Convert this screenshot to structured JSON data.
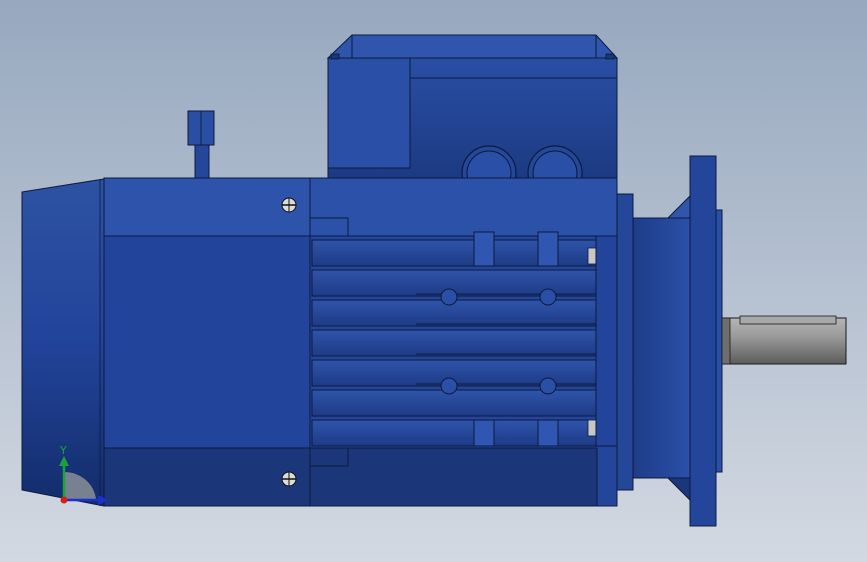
{
  "viewport": {
    "background_top": "#97a8bf",
    "background_bottom": "#d3d9e2"
  },
  "model": {
    "body_color": "#24479a",
    "body_dark": "#1a3678",
    "body_light": "#3359aa",
    "shaft_color": "#8c8c8c",
    "edge_color": "#0d1a3d"
  },
  "triad": {
    "y_label": "Y",
    "x_color": "#1c2fd0",
    "y_color": "#1aa33a",
    "z_color": "#d0201c"
  }
}
